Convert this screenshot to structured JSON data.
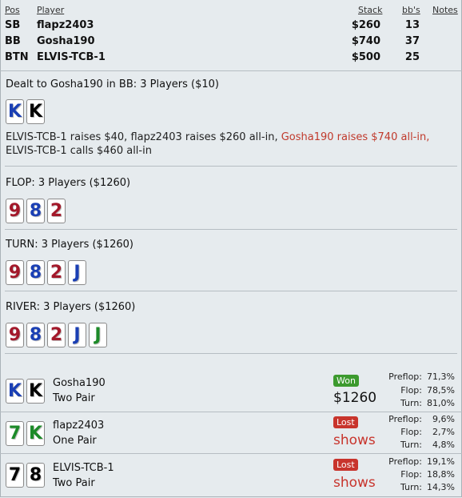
{
  "table": {
    "headers": {
      "pos": "Pos",
      "player": "Player",
      "stack": "Stack",
      "bbs": "bb's",
      "notes": "Notes"
    },
    "players": [
      {
        "pos": "SB",
        "name": "flapz2403",
        "stack": "$260",
        "bbs": "13"
      },
      {
        "pos": "BB",
        "name": "Gosha190",
        "stack": "$740",
        "bbs": "37"
      },
      {
        "pos": "BTN",
        "name": "ELVIS-TCB-1",
        "stack": "$500",
        "bbs": "25"
      }
    ]
  },
  "preflop": {
    "title": "Dealt to Gosha190 in BB: 3 Players ($10)",
    "cards": [
      {
        "rank": "K",
        "color": "blue"
      },
      {
        "rank": "K",
        "color": "black"
      }
    ],
    "action_part1": "ELVIS-TCB-1 raises $40, flapz2403 raises $260 all-in, ",
    "action_highlight": "Gosha190 raises $740 all-in,",
    "action_part2": " ELVIS-TCB-1 calls $460 all-in"
  },
  "flop": {
    "title": "FLOP: 3 Players ($1260)",
    "cards": [
      {
        "rank": "9",
        "color": "red"
      },
      {
        "rank": "8",
        "color": "blue"
      },
      {
        "rank": "2",
        "color": "red"
      }
    ]
  },
  "turn": {
    "title": "TURN: 3 Players ($1260)",
    "cards": [
      {
        "rank": "9",
        "color": "red"
      },
      {
        "rank": "8",
        "color": "blue"
      },
      {
        "rank": "2",
        "color": "red"
      },
      {
        "rank": "J",
        "color": "blue"
      }
    ]
  },
  "river": {
    "title": "RIVER: 3 Players ($1260)",
    "cards": [
      {
        "rank": "9",
        "color": "red"
      },
      {
        "rank": "8",
        "color": "blue"
      },
      {
        "rank": "2",
        "color": "red"
      },
      {
        "rank": "J",
        "color": "blue"
      },
      {
        "rank": "J",
        "color": "green"
      }
    ]
  },
  "results": [
    {
      "name": "Gosha190",
      "hand": "Two Pair",
      "cards": [
        {
          "rank": "K",
          "color": "blue"
        },
        {
          "rank": "K",
          "color": "black"
        }
      ],
      "status": "Won",
      "outcome": "$1260",
      "equity": [
        {
          "label": "Preflop:",
          "value": "71,3%"
        },
        {
          "label": "Flop:",
          "value": "78,5%"
        },
        {
          "label": "Turn:",
          "value": "81,0%"
        }
      ]
    },
    {
      "name": "flapz2403",
      "hand": "One Pair",
      "cards": [
        {
          "rank": "7",
          "color": "green"
        },
        {
          "rank": "K",
          "color": "green"
        }
      ],
      "status": "Lost",
      "outcome": "shows",
      "equity": [
        {
          "label": "Preflop:",
          "value": "9,6%"
        },
        {
          "label": "Flop:",
          "value": "2,7%"
        },
        {
          "label": "Turn:",
          "value": "4,8%"
        }
      ]
    },
    {
      "name": "ELVIS-TCB-1",
      "hand": "Two Pair",
      "cards": [
        {
          "rank": "7",
          "color": "black"
        },
        {
          "rank": "8",
          "color": "black"
        }
      ],
      "status": "Lost",
      "outcome": "shows",
      "equity": [
        {
          "label": "Preflop:",
          "value": "19,1%"
        },
        {
          "label": "Flop:",
          "value": "18,8%"
        },
        {
          "label": "Turn:",
          "value": "14,3%"
        }
      ]
    }
  ],
  "colors": {
    "red": "#a3182a",
    "blue": "#1a3fb4",
    "green": "#1c8a28",
    "black": "#000000",
    "highlight": "#c0392b",
    "won": "#3c9a2e",
    "lost": "#c8342c"
  }
}
